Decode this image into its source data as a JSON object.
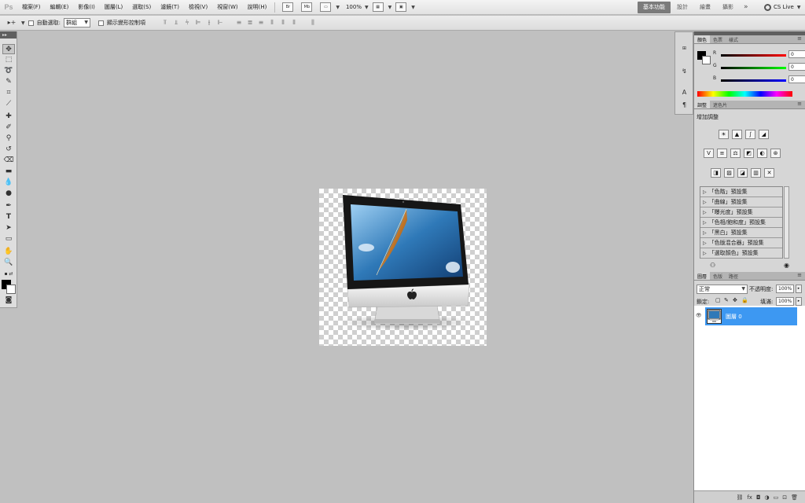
{
  "app": {
    "logo": "Ps"
  },
  "menu": [
    "檔案(F)",
    "編輯(E)",
    "影像(I)",
    "圖層(L)",
    "選取(S)",
    "濾鏡(T)",
    "檢視(V)",
    "視窗(W)",
    "說明(H)"
  ],
  "menubar": {
    "bridge": "Br",
    "minibridge": "Mb",
    "zoom": "100%"
  },
  "workspaces": {
    "active": "基本功能",
    "design": "設計",
    "painting": "繪畫",
    "photography": "攝影",
    "more": "»",
    "cs_live": "CS Live"
  },
  "options": {
    "auto_select_label": "自動選取:",
    "auto_select_value": "群組",
    "show_transform_label": "顯示變形控制項"
  },
  "color_panel": {
    "tabs": [
      "顏色",
      "色票",
      "樣式"
    ],
    "r_label": "R",
    "g_label": "G",
    "b_label": "B",
    "r": "0",
    "g": "0",
    "b": "0",
    "fg": "#000000",
    "bg": "#ffffff"
  },
  "adjustments_panel": {
    "tabs": [
      "調整",
      "遮色片"
    ],
    "title": "增加調整",
    "presets": [
      "「色階」預設集",
      "「曲線」預設集",
      "「曝光度」預設集",
      "「色相/飽和度」預設集",
      "「黑白」預設集",
      "「色版混合器」預設集",
      "「選取顏色」預設集"
    ]
  },
  "layers_panel": {
    "tabs": [
      "圖層",
      "色版",
      "路徑"
    ],
    "blend_mode": "正常",
    "opacity_label": "不透明度:",
    "opacity": "100%",
    "lock_label": "鎖定:",
    "fill_label": "填滿:",
    "fill": "100%",
    "layer_name": "圖層 0"
  },
  "colors": {
    "selection": "#3d98f2",
    "canvas_bg": "#c0c0c0"
  }
}
